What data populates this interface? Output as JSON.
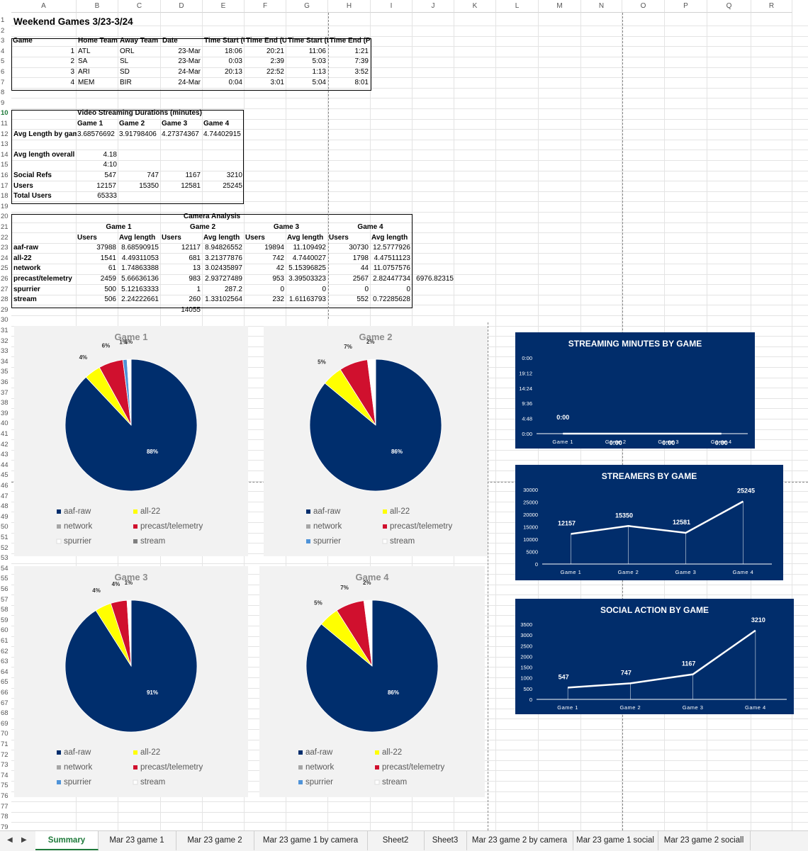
{
  "columns": [
    "A",
    "B",
    "C",
    "D",
    "E",
    "F",
    "G",
    "H",
    "I",
    "J",
    "K",
    "L",
    "M",
    "N",
    "O",
    "P",
    "Q",
    "R"
  ],
  "rows": [
    "1",
    "2",
    "3",
    "4",
    "5",
    "6",
    "7",
    "8",
    "9",
    "10",
    "11",
    "12",
    "13",
    "14",
    "15",
    "16",
    "17",
    "18",
    "19",
    "20",
    "21",
    "22",
    "23",
    "24",
    "25",
    "26",
    "27",
    "28",
    "29",
    "30",
    "31",
    "32",
    "33",
    "34",
    "35",
    "36",
    "37",
    "38",
    "39",
    "40",
    "41",
    "42",
    "43",
    "44",
    "45",
    "46",
    "47",
    "48",
    "49",
    "50",
    "51",
    "52",
    "53",
    "54",
    "55",
    "56",
    "57",
    "58",
    "59",
    "60",
    "61",
    "62",
    "63",
    "64",
    "65",
    "66",
    "67",
    "68",
    "69",
    "70",
    "71",
    "72",
    "73",
    "74",
    "75",
    "76",
    "77",
    "78",
    "79"
  ],
  "title": "Weekend Games 3/23-3/24",
  "games_table": {
    "headers": [
      "Game",
      "Home Team",
      "Away Team",
      "Date",
      "Time Start (U",
      "Time End (UT",
      "Time Start (P",
      "Time End (PT)"
    ],
    "rows": [
      [
        "1",
        "ATL",
        "ORL",
        "23-Mar",
        "18:06",
        "20:21",
        "11:06",
        "1:21"
      ],
      [
        "2",
        "SA",
        "SL",
        "23-Mar",
        "0:03",
        "2:39",
        "5:03",
        "7:39"
      ],
      [
        "3",
        "ARI",
        "SD",
        "24-Mar",
        "20:13",
        "22:52",
        "1:13",
        "3:52"
      ],
      [
        "4",
        "MEM",
        "BIR",
        "24-Mar",
        "0:04",
        "3:01",
        "5:04",
        "8:01"
      ]
    ]
  },
  "video": {
    "title": "Video Streaming Durations (minutes)",
    "game_headers": [
      "Game 1",
      "Game 2",
      "Game 3",
      "Game 4"
    ],
    "avg_label": "Avg Length by gam",
    "avg_values": [
      "3.68576692",
      "3.91798406",
      "4.27374367",
      "4.74402915"
    ],
    "overall_label": "Avg length overall",
    "overall_value": "4.18",
    "overall_time": "4:10",
    "social_label": "Social Refs",
    "social_values": [
      "547",
      "747",
      "1167",
      "3210"
    ],
    "users_label": "Users",
    "users_values": [
      "12157",
      "15350",
      "12581",
      "25245"
    ],
    "total_label": "Total Users",
    "total_value": "65333"
  },
  "camera": {
    "title": "Camera Analysis",
    "games": [
      "Game 1",
      "Game 2",
      "Game 3",
      "Game 4"
    ],
    "sub_headers": [
      "Users",
      "Avg length"
    ],
    "rows": [
      {
        "name": "aaf-raw",
        "vals": [
          "37988",
          "8.68590915",
          "12117",
          "8.94826552",
          "19894",
          "11.109492",
          "30730",
          "12.5777926"
        ]
      },
      {
        "name": "all-22",
        "vals": [
          "1541",
          "4.49311053",
          "681",
          "3.21377876",
          "742",
          "4.7440027",
          "1798",
          "4.47511123"
        ]
      },
      {
        "name": "network",
        "vals": [
          "61",
          "1.74863388",
          "13",
          "3.02435897",
          "42",
          "5.15396825",
          "44",
          "11.0757576"
        ]
      },
      {
        "name": "precast/telemetry",
        "vals": [
          "2459",
          "5.66636136",
          "983",
          "2.93727489",
          "953",
          "3.39503323",
          "2567",
          "2.82447734"
        ]
      },
      {
        "name": "spurrier",
        "vals": [
          "500",
          "5.12163333",
          "1",
          "287.2",
          "0",
          "0",
          "0",
          "0"
        ]
      },
      {
        "name": "stream",
        "vals": [
          "506",
          "2.24222661",
          "260",
          "1.33102564",
          "232",
          "1.61163793",
          "552",
          "0.72285628"
        ]
      }
    ],
    "extra_value": "6976.82315",
    "total_below": "14055"
  },
  "pie_colors": {
    "aaf-raw": "#002e6d",
    "all-22": "#ffff00",
    "network": "#a6a6a6",
    "precast/telemetry": "#d0102e",
    "spurrier": "#4f93d8",
    "stream": "#ffffff"
  },
  "pies": [
    {
      "title": "Game 1",
      "slices": [
        {
          "name": "aaf-raw",
          "pct": 88
        },
        {
          "name": "all-22",
          "pct": 4
        },
        {
          "name": "precast/telemetry",
          "pct": 6
        },
        {
          "name": "network",
          "pct": 0
        },
        {
          "name": "spurrier",
          "pct": 1
        },
        {
          "name": "stream",
          "pct": 1
        }
      ],
      "labels": [
        "88%",
        "4%",
        "6%",
        "1%",
        "1%"
      ],
      "legend": [
        "aaf-raw",
        "all-22",
        "network",
        "precast/telemetry",
        "spurrier",
        "stream"
      ],
      "legend_colors": [
        "#002e6d",
        "#ffff00",
        "#a6a6a6",
        "#d0102e",
        "#ffffff",
        "#7f7f7f"
      ]
    },
    {
      "title": "Game 2",
      "slices": [
        {
          "name": "aaf-raw",
          "pct": 86
        },
        {
          "name": "all-22",
          "pct": 5
        },
        {
          "name": "precast/telemetry",
          "pct": 7
        },
        {
          "name": "stream",
          "pct": 2
        }
      ],
      "labels": [
        "86%",
        "5%",
        "7%",
        "2%"
      ],
      "legend": [
        "aaf-raw",
        "all-22",
        "network",
        "precast/telemetry",
        "spurrier",
        "stream"
      ],
      "legend_colors": [
        "#002e6d",
        "#ffff00",
        "#a6a6a6",
        "#d0102e",
        "#4f93d8",
        "#ffffff"
      ]
    },
    {
      "title": "Game 3",
      "slices": [
        {
          "name": "aaf-raw",
          "pct": 91
        },
        {
          "name": "all-22",
          "pct": 4
        },
        {
          "name": "precast/telemetry",
          "pct": 4
        },
        {
          "name": "stream",
          "pct": 1
        }
      ],
      "labels": [
        "91%",
        "4%",
        "4%",
        "1%"
      ],
      "legend": [
        "aaf-raw",
        "all-22",
        "network",
        "precast/telemetry",
        "spurrier",
        "stream"
      ],
      "legend_colors": [
        "#002e6d",
        "#ffff00",
        "#a6a6a6",
        "#d0102e",
        "#4f93d8",
        "#ffffff"
      ]
    },
    {
      "title": "Game 4",
      "slices": [
        {
          "name": "aaf-raw",
          "pct": 86
        },
        {
          "name": "all-22",
          "pct": 5
        },
        {
          "name": "precast/telemetry",
          "pct": 7
        },
        {
          "name": "stream",
          "pct": 2
        }
      ],
      "labels": [
        "86%",
        "5%",
        "7%",
        "2%"
      ],
      "legend": [
        "aaf-raw",
        "all-22",
        "network",
        "precast/telemetry",
        "spurrier",
        "stream"
      ],
      "legend_colors": [
        "#002e6d",
        "#ffff00",
        "#a6a6a6",
        "#d0102e",
        "#4f93d8",
        "#ffffff"
      ]
    }
  ],
  "chart_data": [
    {
      "type": "pie",
      "title": "Game 1",
      "categories": [
        "aaf-raw",
        "all-22",
        "network",
        "precast/telemetry",
        "spurrier",
        "stream"
      ],
      "values": [
        88,
        4,
        0,
        6,
        1,
        1
      ]
    },
    {
      "type": "pie",
      "title": "Game 2",
      "categories": [
        "aaf-raw",
        "all-22",
        "network",
        "precast/telemetry",
        "spurrier",
        "stream"
      ],
      "values": [
        86,
        5,
        0,
        7,
        0,
        2
      ]
    },
    {
      "type": "pie",
      "title": "Game 3",
      "categories": [
        "aaf-raw",
        "all-22",
        "network",
        "precast/telemetry",
        "spurrier",
        "stream"
      ],
      "values": [
        91,
        4,
        0,
        4,
        0,
        1
      ]
    },
    {
      "type": "pie",
      "title": "Game 4",
      "categories": [
        "aaf-raw",
        "all-22",
        "network",
        "precast/telemetry",
        "spurrier",
        "stream"
      ],
      "values": [
        86,
        5,
        0,
        7,
        0,
        2
      ]
    },
    {
      "type": "line",
      "title": "STREAMING MINUTES BY GAME",
      "categories": [
        "Game 1",
        "Game 2",
        "Game 3",
        "Game 4"
      ],
      "values": [
        0,
        0,
        0,
        0
      ],
      "data_labels": [
        "0:00",
        "0:00",
        "0:00",
        "0:00"
      ],
      "yticks": [
        "0:00",
        "4:48",
        "9:36",
        "14:24",
        "19:12",
        "0:00"
      ]
    },
    {
      "type": "line",
      "title": "STREAMERS BY GAME",
      "categories": [
        "Game 1",
        "Game 2",
        "Game 3",
        "Game 4"
      ],
      "values": [
        12157,
        15350,
        12581,
        25245
      ],
      "ylim": [
        0,
        30000
      ],
      "yticks": [
        "0",
        "5000",
        "10000",
        "15000",
        "20000",
        "25000",
        "30000"
      ]
    },
    {
      "type": "line",
      "title": "SOCIAL ACTION BY GAME",
      "categories": [
        "Game 1",
        "Game 2",
        "Game 3",
        "Game 4"
      ],
      "values": [
        547,
        747,
        1167,
        3210
      ],
      "ylim": [
        0,
        3500
      ],
      "yticks": [
        "0",
        "500",
        "1000",
        "1500",
        "2000",
        "2500",
        "3000",
        "3500"
      ]
    }
  ],
  "tabs": [
    "Summary",
    "Mar 23 game 1",
    "Mar 23 game 2",
    "Mar 23 game 1 by camera",
    "Sheet2",
    "Sheet3",
    "Mar 23 game 2 by camera",
    "Mar 23 game 1 social",
    "Mar 23 game 2 sociall"
  ]
}
